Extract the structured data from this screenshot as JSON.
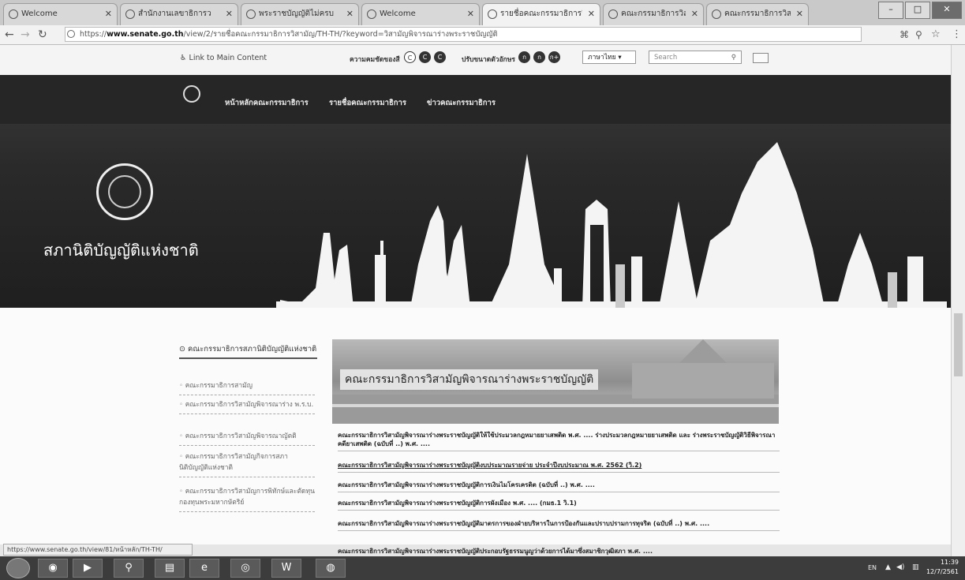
{
  "browser": {
    "tabs": [
      {
        "label": "Welcome",
        "active": false
      },
      {
        "label": "สำนักงานเลขาธิการว",
        "active": false
      },
      {
        "label": "พระราชบัญญัติไม่ครบ",
        "active": false
      },
      {
        "label": "Welcome",
        "active": false
      },
      {
        "label": "รายชื่อคณะกรรมาธิการวิ",
        "active": true
      },
      {
        "label": "คณะกรรมาธิการวิสามัญ",
        "active": false
      },
      {
        "label": "คณะกรรมาธิการวิสามัญ",
        "active": false
      }
    ],
    "url_scheme": "https://",
    "url_host": "www.senate.go.th",
    "url_path": "/view/2/รายชื่อคณะกรรมาธิการวิสามัญ/TH-TH/?keyword=วิสามัญพิจารณาร่างพระราชบัญญัติ",
    "status_url": "https://www.senate.go.th/view/81/หน้าหลัก/TH-TH/"
  },
  "utility": {
    "skip_link": "Link to Main Content",
    "contrast_label": "ความคมชัดของสี",
    "contrast_buttons": [
      "C",
      "C",
      "C"
    ],
    "fontsize_label": "ปรับขนาดตัวอักษร",
    "fontsize_buttons": [
      "ก",
      "ก",
      "ก+"
    ],
    "language": "ภาษาไทย",
    "search_placeholder": "Search"
  },
  "nav": {
    "items": [
      "หน้าหลักคณะกรรมาธิการ",
      "รายชื่อคณะกรรมาธิการ",
      "ข่าวคณะกรรมาธิการ"
    ]
  },
  "site": {
    "name": "สภานิติบัญญัติแห่งชาติ"
  },
  "sidebar": {
    "heading": "คณะกรรมาธิการสภานิติบัญญัติแห่งชาติ",
    "items": [
      "คณะกรรมาธิการสามัญ",
      "คณะกรรมาธิการวิสามัญพิจารณาร่าง พ.ร.บ.",
      "คณะกรรมาธิการวิสามัญพิจารณาญัตติ",
      "คณะกรรมาธิการวิสามัญกิจการสภานิติบัญญัติแห่งชาติ",
      "คณะกรรมาธิการวิสามัญการพิทักษ์และตัดทุนกองทุนพระมหากษัตริย์"
    ]
  },
  "main": {
    "hero_title": "คณะกรรมาธิการวิสามัญพิจารณาร่างพระราชบัญญัติ",
    "rows": [
      "คณะกรรมาธิการวิสามัญพิจารณาร่างพระราชบัญญัติให้ใช้ประมวลกฎหมายยาเสพติด พ.ศ. .... ร่างประมวลกฎหมายยาเสพติด และ ร่างพระราชบัญญัติวิธีพิจารณาคดียาเสพติด (ฉบับที่ ..) พ.ศ. ....",
      "คณะกรรมาธิการวิสามัญพิจารณาร่างพระราชบัญญัติงบประมาณรายจ่าย ประจำปีงบประมาณ พ.ศ. 2562 (วิ.2)",
      "คณะกรรมาธิการวิสามัญพิจารณาร่างพระราชบัญญัติการเงินไมโครเครดิต (ฉบับที่ ..) พ.ศ. ....",
      "คณะกรรมาธิการวิสามัญพิจารณาร่างพระราชบัญญัติการผังเมือง พ.ศ. .... (กมธ.1 วิ.1)",
      "คณะกรรมาธิการวิสามัญพิจารณาร่างพระราชบัญญัติมาตรการของฝ่ายบริหารในการป้องกันและปราบปรามการทุจริต (ฉบับที่ ..) พ.ศ. ....",
      "คณะกรรมาธิการวิสามัญพิจารณาร่างพระราชบัญญัติประกอบรัฐธรรมนูญว่าด้วยการได้มาซึ่งสมาชิกวุฒิสภา พ.ศ. ...."
    ]
  },
  "taskbar": {
    "lang": "EN",
    "time": "11:39",
    "date": "12/7/2561"
  }
}
